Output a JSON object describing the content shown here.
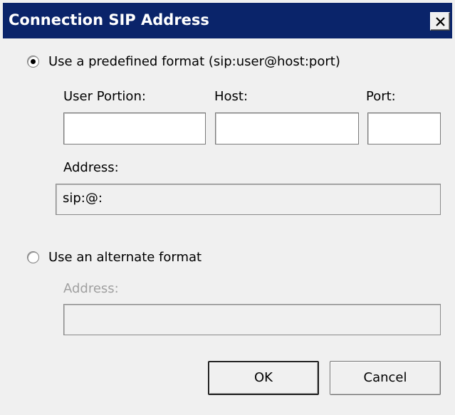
{
  "dialog": {
    "title": "Connection SIP Address",
    "close_icon": "close-x-icon"
  },
  "predefined": {
    "radio_label": "Use a predefined format (sip:user@host:port)",
    "selected": true,
    "user_portion_label": "User Portion:",
    "host_label": "Host:",
    "port_label": "Port:",
    "user_portion_value": "",
    "host_value": "",
    "port_value": "",
    "address_label": "Address:",
    "address_value": "sip:@:"
  },
  "alternate": {
    "radio_label": "Use an alternate format",
    "selected": false,
    "address_label": "Address:",
    "address_value": ""
  },
  "buttons": {
    "ok_label": "OK",
    "cancel_label": "Cancel"
  },
  "colors": {
    "titlebar": "#0a246a",
    "background": "#f0f0f0",
    "disabled_text": "#a0a0a0"
  }
}
